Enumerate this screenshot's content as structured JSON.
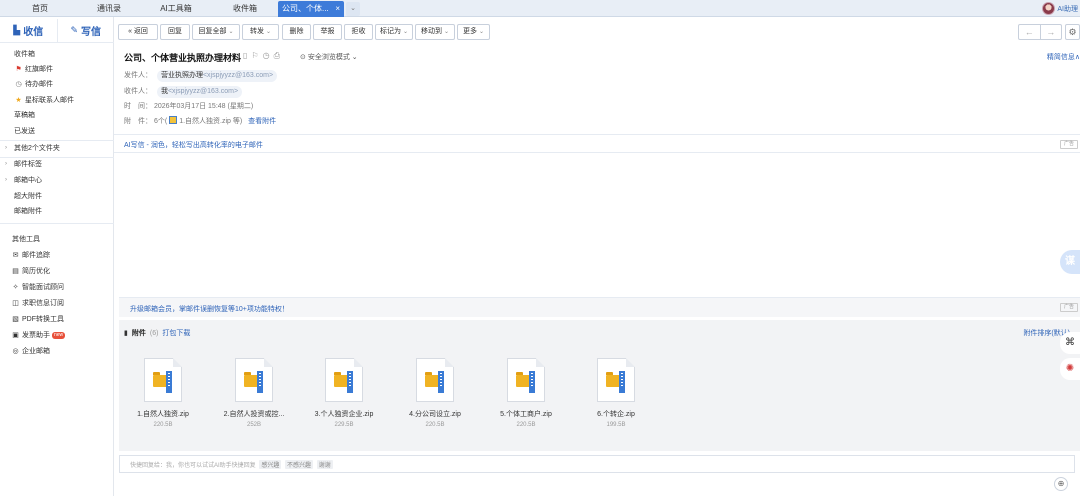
{
  "tabs": [
    {
      "label": "首页"
    },
    {
      "label": "通讯录"
    },
    {
      "label": "AI工具箱"
    },
    {
      "label": "收件箱"
    },
    {
      "label": "公司、个体...",
      "close": "×"
    }
  ],
  "tab_more": "⌄",
  "ai_helper": "AI助理",
  "compose": {
    "receive": "收信",
    "write": "写信"
  },
  "sidebar": {
    "inbox": "收件箱",
    "flagged": "红旗邮件",
    "todo": "待办邮件",
    "starred": "星标联系人邮件",
    "drafts": "草稿箱",
    "sent": "已发送",
    "other_folders": "其他2个文件夹",
    "tags": "邮件标签",
    "center": "邮箱中心",
    "large_att": "超大附件",
    "mail_att": "邮箱附件",
    "tools_title": "其他工具",
    "tools": [
      "邮件追踪",
      "简历优化",
      "智能面试顾问",
      "求职信息订阅",
      "PDF转换工具",
      "发票助手",
      "企业邮箱"
    ],
    "new_badge": "new"
  },
  "toolbar": {
    "back": "返回",
    "reply": "回复",
    "reply_all": "回复全部",
    "forward": "转发",
    "delete": "删除",
    "report": "举报",
    "reject": "拒收",
    "mark_as": "标记为",
    "move_to": "移动到",
    "more": "更多"
  },
  "mail": {
    "subject": "公司、个体营业执照办理材料",
    "safe_mode": "安全浏览模式",
    "detail_link": "精简信息∧",
    "from_label": "发件人：",
    "from_name": "营业执照办理",
    "from_addr": "<xjspjyyzz@163.com>",
    "to_label": "收件人：",
    "to_name": "我",
    "to_addr": "<xjspjyyzz@163.com>",
    "time_label": "时　间：",
    "time_value": "2026年03月17日 15:48 (星期二)",
    "att_label": "附　件：",
    "att_summary_pre": "6个(",
    "att_summary_file": "1.自然人独资.zip 等)",
    "view_att": "查看附件"
  },
  "ai_bar": {
    "text": "AI写信 - 润色，轻松写出高转化率的电子邮件",
    "ad": "广告"
  },
  "upgrade": {
    "text": "升级邮箱会员，掌邮件误删恢复等10+项功能特权！",
    "ad": "广告"
  },
  "side_float": "谋",
  "attachments": {
    "title": "附件",
    "count": "(6)",
    "download": "打包下载",
    "sort": "附件排序(默认)",
    "files": [
      {
        "name": "1.自然人独资.zip",
        "size": "220.5B"
      },
      {
        "name": "2.自然人投资或控...",
        "size": "252B"
      },
      {
        "name": "3.个人独资企业.zip",
        "size": "229.5B"
      },
      {
        "name": "4.分公司设立.zip",
        "size": "220.5B"
      },
      {
        "name": "5.个体工商户.zip",
        "size": "220.5B"
      },
      {
        "name": "6.个转企.zip",
        "size": "199.5B"
      }
    ]
  },
  "quick_reply": {
    "placeholder": "快捷回复给：我，你也可以试试AI助手快捷回复",
    "chips": [
      "感兴趣",
      "不感兴趣",
      "谢谢"
    ]
  }
}
